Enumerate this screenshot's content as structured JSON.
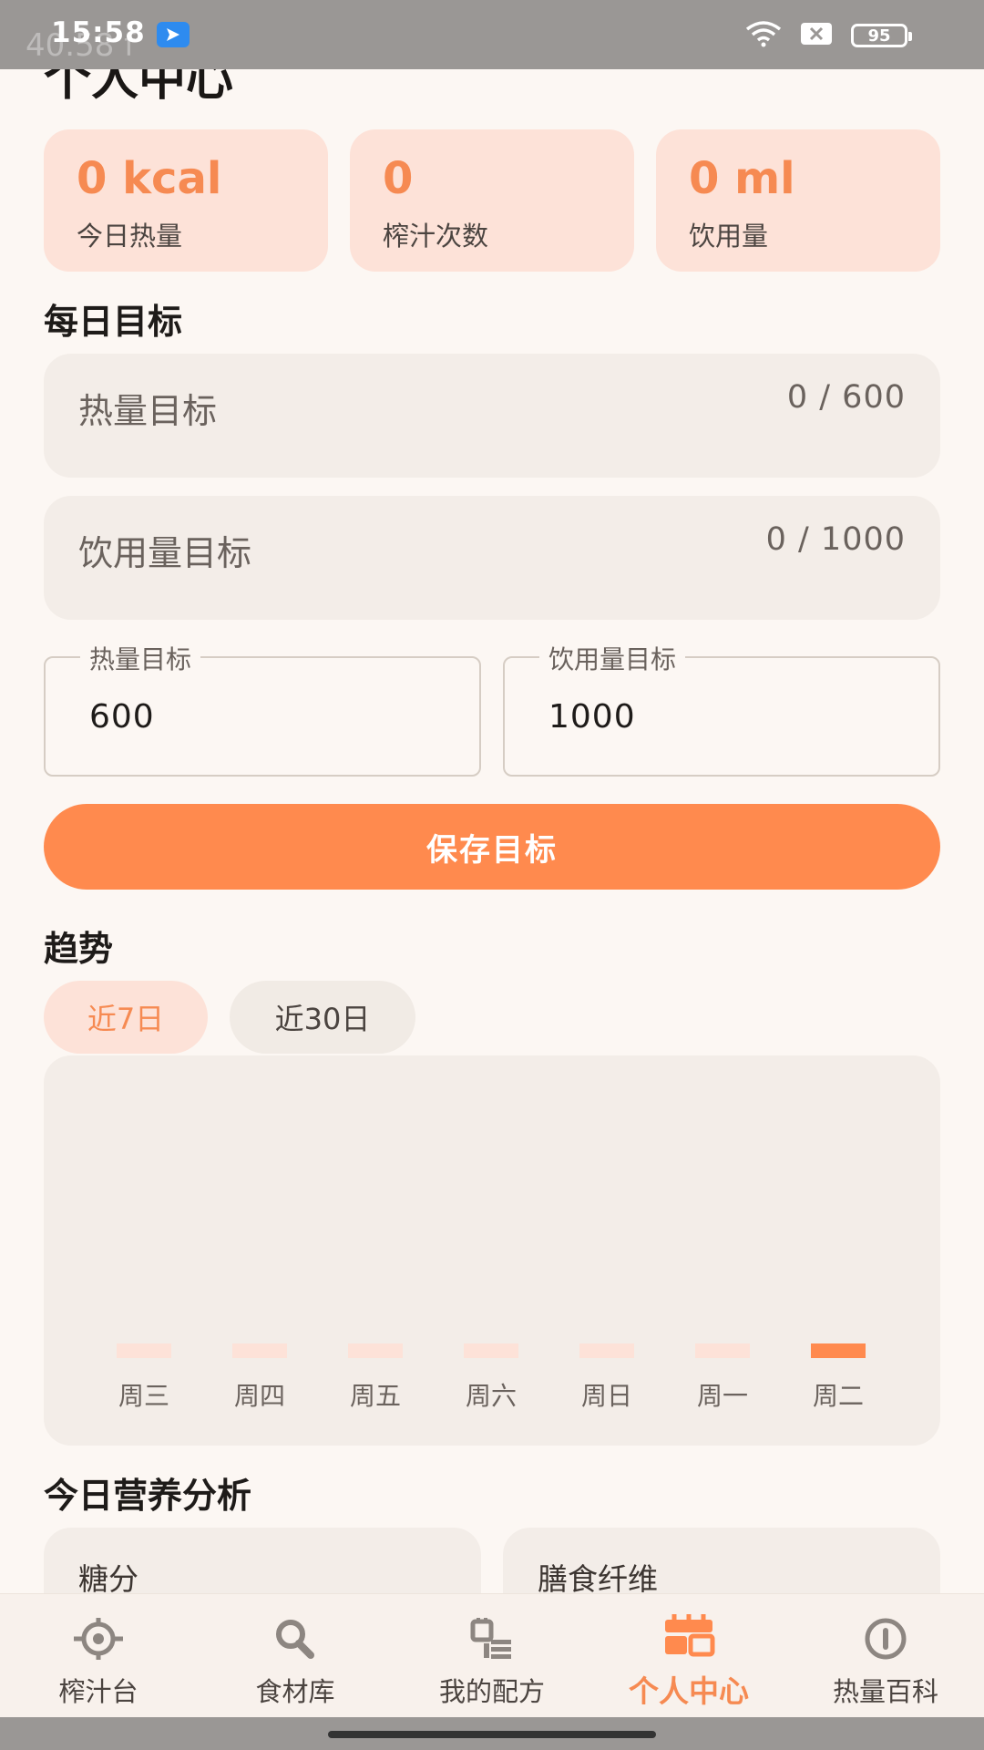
{
  "status": {
    "time": "15:58",
    "battery": "95",
    "ghost": "40.58 f"
  },
  "page": {
    "title": "个人中心"
  },
  "stats": [
    {
      "value": "0 kcal",
      "label": "今日热量"
    },
    {
      "value": "0",
      "label": "榨汁次数"
    },
    {
      "value": "0 ml",
      "label": "饮用量"
    }
  ],
  "daily_goals": {
    "title": "每日目标",
    "rows": [
      {
        "name": "热量目标",
        "progress": "0 / 600",
        "current": 0,
        "target": 600
      },
      {
        "name": "饮用量目标",
        "progress": "0 / 1000",
        "current": 0,
        "target": 1000
      }
    ],
    "fields": [
      {
        "label": "热量目标",
        "value": "600"
      },
      {
        "label": "饮用量目标",
        "value": "1000"
      }
    ],
    "save_label": "保存目标"
  },
  "trend": {
    "title": "趋势",
    "tabs": [
      {
        "label": "近7日",
        "active": true
      },
      {
        "label": "近30日",
        "active": false
      }
    ]
  },
  "chart_data": {
    "type": "bar",
    "categories": [
      "周三",
      "周四",
      "周五",
      "周六",
      "周日",
      "周一",
      "周二"
    ],
    "values": [
      0,
      0,
      0,
      0,
      0,
      0,
      0
    ],
    "highlight_index": 6,
    "colors": {
      "bar": "#FDE2D8",
      "highlight": "#FF8A4E",
      "label": "#6A625D"
    }
  },
  "nutrition": {
    "title": "今日营养分析",
    "cards": [
      {
        "title": "糖分"
      },
      {
        "title": "膳食纤维"
      }
    ]
  },
  "nav": [
    {
      "label": "榨汁台",
      "icon": "juicer-icon",
      "active": false
    },
    {
      "label": "食材库",
      "icon": "search-icon",
      "active": false
    },
    {
      "label": "我的配方",
      "icon": "recipe-icon",
      "active": false
    },
    {
      "label": "个人中心",
      "icon": "profile-icon",
      "active": true
    },
    {
      "label": "热量百科",
      "icon": "info-icon",
      "active": false
    }
  ],
  "colors": {
    "accent": "#FF8A4E",
    "accent_soft": "#FDE2D8",
    "background": "#FCF7F3",
    "surface": "#F3EDE8"
  }
}
